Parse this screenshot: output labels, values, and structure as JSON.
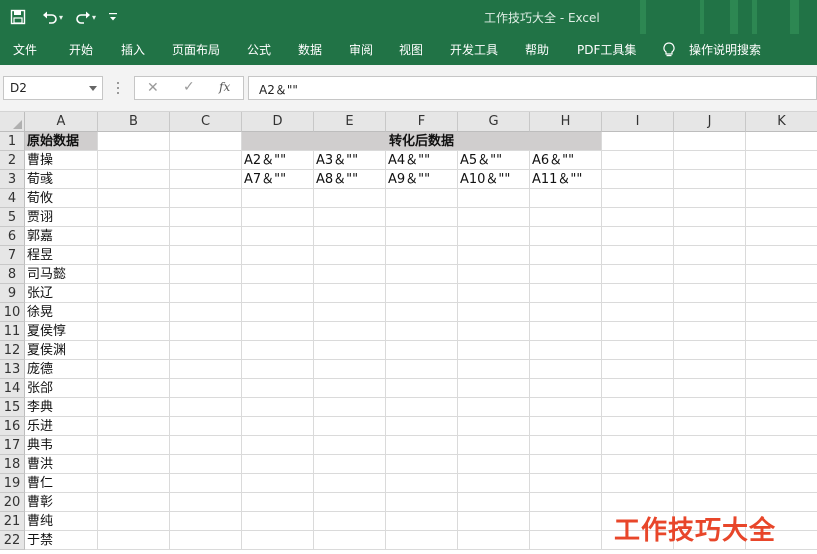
{
  "window": {
    "title": "工作技巧大全  -  Excel"
  },
  "ribbon": {
    "tabs": [
      "文件",
      "开始",
      "插入",
      "页面布局",
      "公式",
      "数据",
      "审阅",
      "视图",
      "开发工具",
      "帮助",
      "PDF工具集"
    ],
    "tell_me": "操作说明搜索"
  },
  "formula_bar": {
    "name_box": "D2",
    "fx_label": "fx",
    "formula": "A2＆\"\""
  },
  "sheet": {
    "columns": [
      "A",
      "B",
      "C",
      "D",
      "E",
      "F",
      "G",
      "H",
      "I",
      "J",
      "K"
    ],
    "rows": [
      "1",
      "2",
      "3",
      "4",
      "5",
      "6",
      "7",
      "8",
      "9",
      "10",
      "11",
      "12",
      "13",
      "14",
      "15",
      "16",
      "17",
      "18",
      "19",
      "20",
      "21",
      "22"
    ],
    "a_header": "原始数据",
    "a_values": [
      "曹操",
      "荀彧",
      "荀攸",
      "贾诩",
      "郭嘉",
      "程昱",
      "司马懿",
      "张辽",
      "徐晃",
      "夏侯惇",
      "夏侯渊",
      "庞德",
      "张郃",
      "李典",
      "乐进",
      "典韦",
      "曹洪",
      "曹仁",
      "曹彰",
      "曹纯",
      "于禁"
    ],
    "merged_header": "转化后数据",
    "row2": [
      "A2＆\"\"",
      "A3＆\"\"",
      "A4＆\"\"",
      "A5＆\"\"",
      "A6＆\"\""
    ],
    "row3": [
      "A7＆\"\"",
      "A8＆\"\"",
      "A9＆\"\"",
      "A10＆\"\"",
      "A11＆\"\""
    ]
  },
  "watermark": "工作技巧大全",
  "colors": {
    "excel_green": "#217346",
    "header_fill": "#d0cece",
    "watermark": "#e8462a"
  }
}
